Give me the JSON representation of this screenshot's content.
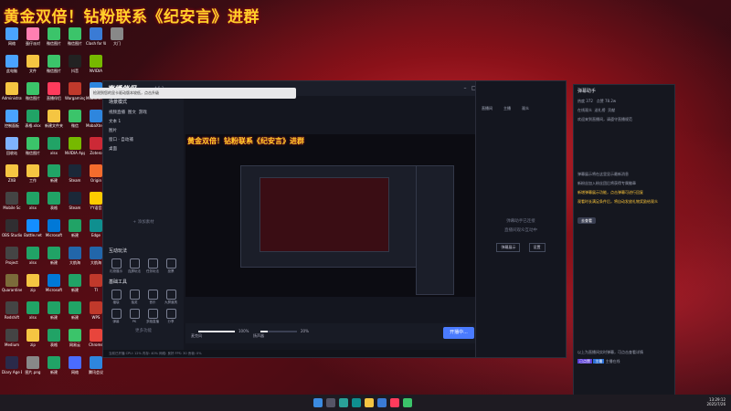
{
  "banner": {
    "text": "黄金双倍！钻粉联系《纪安言》进群"
  },
  "desktop": {
    "icons": [
      {
        "label": "网络",
        "color": "#4aa3ff",
        "col": 0,
        "row": 0
      },
      {
        "label": "蛋仔派对",
        "color": "#ff7fb1",
        "col": 1,
        "row": 0
      },
      {
        "label": "微信图片",
        "color": "#3bc46a",
        "col": 2,
        "row": 0
      },
      {
        "label": "微信图片",
        "color": "#3bc46a",
        "col": 3,
        "row": 0
      },
      {
        "label": "Clash for Windows",
        "color": "#3a7bd5",
        "col": 4,
        "row": 0
      },
      {
        "label": "大门",
        "color": "#888888",
        "col": 5,
        "row": 0
      },
      {
        "label": "此电脑",
        "color": "#4aa3ff",
        "col": 0,
        "row": 1
      },
      {
        "label": "文件",
        "color": "#f5c542",
        "col": 1,
        "row": 1
      },
      {
        "label": "微信图片",
        "color": "#3bc46a",
        "col": 2,
        "row": 1
      },
      {
        "label": "抖音",
        "color": "#222222",
        "col": 3,
        "row": 1
      },
      {
        "label": "NVIDIA",
        "color": "#76b900",
        "col": 4,
        "row": 1
      },
      {
        "label": "Administrator",
        "color": "#f5c542",
        "col": 0,
        "row": 2
      },
      {
        "label": "微信图片",
        "color": "#3bc46a",
        "col": 1,
        "row": 2
      },
      {
        "label": "直播伴侣",
        "color": "#ff3b5c",
        "col": 2,
        "row": 2
      },
      {
        "label": "Wargaming",
        "color": "#c0392b",
        "col": 3,
        "row": 2
      },
      {
        "label": "MobaXterm",
        "color": "#2e86de",
        "col": 4,
        "row": 2
      },
      {
        "label": "控制面板",
        "color": "#4aa3ff",
        "col": 0,
        "row": 3
      },
      {
        "label": "表格.xlsx",
        "color": "#21a366",
        "col": 1,
        "row": 3
      },
      {
        "label": "新建文件夹",
        "color": "#f5c542",
        "col": 2,
        "row": 3
      },
      {
        "label": "微信",
        "color": "#3bc46a",
        "col": 3,
        "row": 3
      },
      {
        "label": "MobaXterm",
        "color": "#2e86de",
        "col": 4,
        "row": 3
      },
      {
        "label": "回收站",
        "color": "#7fb3ff",
        "col": 0,
        "row": 4
      },
      {
        "label": "微信图片",
        "color": "#3bc46a",
        "col": 1,
        "row": 4
      },
      {
        "label": "xlsx",
        "color": "#21a366",
        "col": 2,
        "row": 4
      },
      {
        "label": "NVIDIA App",
        "color": "#76b900",
        "col": 3,
        "row": 4
      },
      {
        "label": "Zotero",
        "color": "#cc2936",
        "col": 4,
        "row": 4
      },
      {
        "label": "ZXB",
        "color": "#f5c542",
        "col": 0,
        "row": 5
      },
      {
        "label": "工作",
        "color": "#f5c542",
        "col": 1,
        "row": 5
      },
      {
        "label": "新建",
        "color": "#21a366",
        "col": 2,
        "row": 5
      },
      {
        "label": "Steam",
        "color": "#1b2838",
        "col": 3,
        "row": 5
      },
      {
        "label": "Origin",
        "color": "#f56c2d",
        "col": 4,
        "row": 5
      },
      {
        "label": "Mobile Sc",
        "color": "#444444",
        "col": 0,
        "row": 6
      },
      {
        "label": "xlsx",
        "color": "#21a366",
        "col": 1,
        "row": 6
      },
      {
        "label": "表格",
        "color": "#21a366",
        "col": 2,
        "row": 6
      },
      {
        "label": "Steam",
        "color": "#1b2838",
        "col": 3,
        "row": 6
      },
      {
        "label": "YY语音",
        "color": "#ffcc00",
        "col": 4,
        "row": 6
      },
      {
        "label": "OBS Studio",
        "color": "#302e31",
        "col": 0,
        "row": 7
      },
      {
        "label": "Battle.net",
        "color": "#148eff",
        "col": 1,
        "row": 7
      },
      {
        "label": "Microsoft",
        "color": "#0078d7",
        "col": 2,
        "row": 7
      },
      {
        "label": "新建",
        "color": "#21a366",
        "col": 3,
        "row": 7
      },
      {
        "label": "Edge",
        "color": "#0f8f8f",
        "col": 4,
        "row": 7
      },
      {
        "label": "Project",
        "color": "#444444",
        "col": 0,
        "row": 8
      },
      {
        "label": "xlsx",
        "color": "#21a366",
        "col": 1,
        "row": 8
      },
      {
        "label": "新建",
        "color": "#21a366",
        "col": 2,
        "row": 8
      },
      {
        "label": "大航海",
        "color": "#2266aa",
        "col": 3,
        "row": 8
      },
      {
        "label": "大航海",
        "color": "#2266aa",
        "col": 4,
        "row": 8
      },
      {
        "label": "Quarantine Zone",
        "color": "#7b6b3a",
        "col": 0,
        "row": 9
      },
      {
        "label": "zip",
        "color": "#f5c542",
        "col": 1,
        "row": 9
      },
      {
        "label": "Microsoft",
        "color": "#0078d7",
        "col": 2,
        "row": 9
      },
      {
        "label": "新建",
        "color": "#21a366",
        "col": 3,
        "row": 9
      },
      {
        "label": "TI",
        "color": "#c0392b",
        "col": 4,
        "row": 9
      },
      {
        "label": "Redshift",
        "color": "#444444",
        "col": 0,
        "row": 10
      },
      {
        "label": "xlsx",
        "color": "#21a366",
        "col": 1,
        "row": 10
      },
      {
        "label": "新建",
        "color": "#21a366",
        "col": 2,
        "row": 10
      },
      {
        "label": "新建",
        "color": "#21a366",
        "col": 3,
        "row": 10
      },
      {
        "label": "WPS",
        "color": "#c0392b",
        "col": 4,
        "row": 10
      },
      {
        "label": "Medium",
        "color": "#444444",
        "col": 0,
        "row": 11
      },
      {
        "label": "zip",
        "color": "#f5c542",
        "col": 1,
        "row": 11
      },
      {
        "label": "表格",
        "color": "#21a366",
        "col": 2,
        "row": 11
      },
      {
        "label": "网易云",
        "color": "#3bc46a",
        "col": 3,
        "row": 11
      },
      {
        "label": "Chrome",
        "color": "#e8453c",
        "col": 4,
        "row": 11
      },
      {
        "label": "Diary Age Billionaire",
        "color": "#2a2a4a",
        "col": 0,
        "row": 12
      },
      {
        "label": "图片.png",
        "color": "#888888",
        "col": 1,
        "row": 12
      },
      {
        "label": "新建",
        "color": "#21a366",
        "col": 2,
        "row": 12
      },
      {
        "label": "网络",
        "color": "#4a6cff",
        "col": 3,
        "row": 12
      },
      {
        "label": "腾讯会议",
        "color": "#2e86de",
        "col": 4,
        "row": 12
      }
    ]
  },
  "app": {
    "logo": "直播伴侣",
    "version": "4.5.3",
    "notification": "检测到您的显卡驱动版本较低，点击升级",
    "sidebar": {
      "scene_title": "场景模式",
      "tabs": [
        "视频直播",
        "图文",
        "游戏"
      ],
      "scene_rows": [
        "文本 1",
        "图片",
        "窗口 · 自动捕",
        "桌面"
      ],
      "add_source": "+ 添加素材",
      "interact_title": "互动玩法",
      "interact_buttons": [
        "礼物展示",
        "连屏玩法",
        "任务玩法",
        "投票"
      ],
      "tools_title": "基础工具",
      "tools_buttons": [
        "福袋",
        "抽奖",
        "音乐",
        "大屏道具",
        "弹幕",
        "PK",
        "多路直播",
        "分享"
      ],
      "more": "更多功能"
    },
    "bottombar": {
      "mic_label": "麦克风",
      "mic_value": "100%",
      "speaker_label": "扬声器",
      "speaker_value": "20%",
      "golive": "开播中..."
    },
    "statusbar": "当前已开播  CPU: 12%  内存: 40%  网络: 良好  FPS: 30  丢帧: 0%"
  },
  "dock": {
    "tabs": [
      "直播间",
      "主播",
      "观众",
      "福利",
      "设置"
    ],
    "notice_line1": "弹幕助手已连接",
    "notice_line2": "直播间观众互动中",
    "btn1": "弹幕展示",
    "btn2": "设置"
  },
  "panel": {
    "title": "弹幕助手",
    "stats": [
      "热度 372",
      "点赞 78.2w"
    ],
    "tabs": [
      "在线观众",
      "送礼榜",
      "贡献"
    ],
    "rows": [
      "欢迎来到直播间，请遵守直播规范",
      "弹幕展示将在这里显示最新消息",
      "新粉丝加入粉丝团后将获得专属徽章"
    ],
    "highlights": [
      "新增弹幕展示功能，点击弹幕可进行回复",
      "观看时长满足条件后，将自动发放礼物奖励给观众"
    ],
    "button": "去查看",
    "bottom_note": "以上为直播间实时弹幕，可点击查看详情",
    "footer_tags": [
      "已点赞",
      "主播",
      "主播在线"
    ],
    "bottom_bar": [
      "音乐",
      "连麦",
      "PK",
      "更多"
    ]
  },
  "taskbar": {
    "apps": [
      "start",
      "search",
      "taskview",
      "edge",
      "explorer",
      "store",
      "live",
      "wechat"
    ],
    "clock_time": "13:29:12",
    "clock_date": "2025/7/26"
  }
}
